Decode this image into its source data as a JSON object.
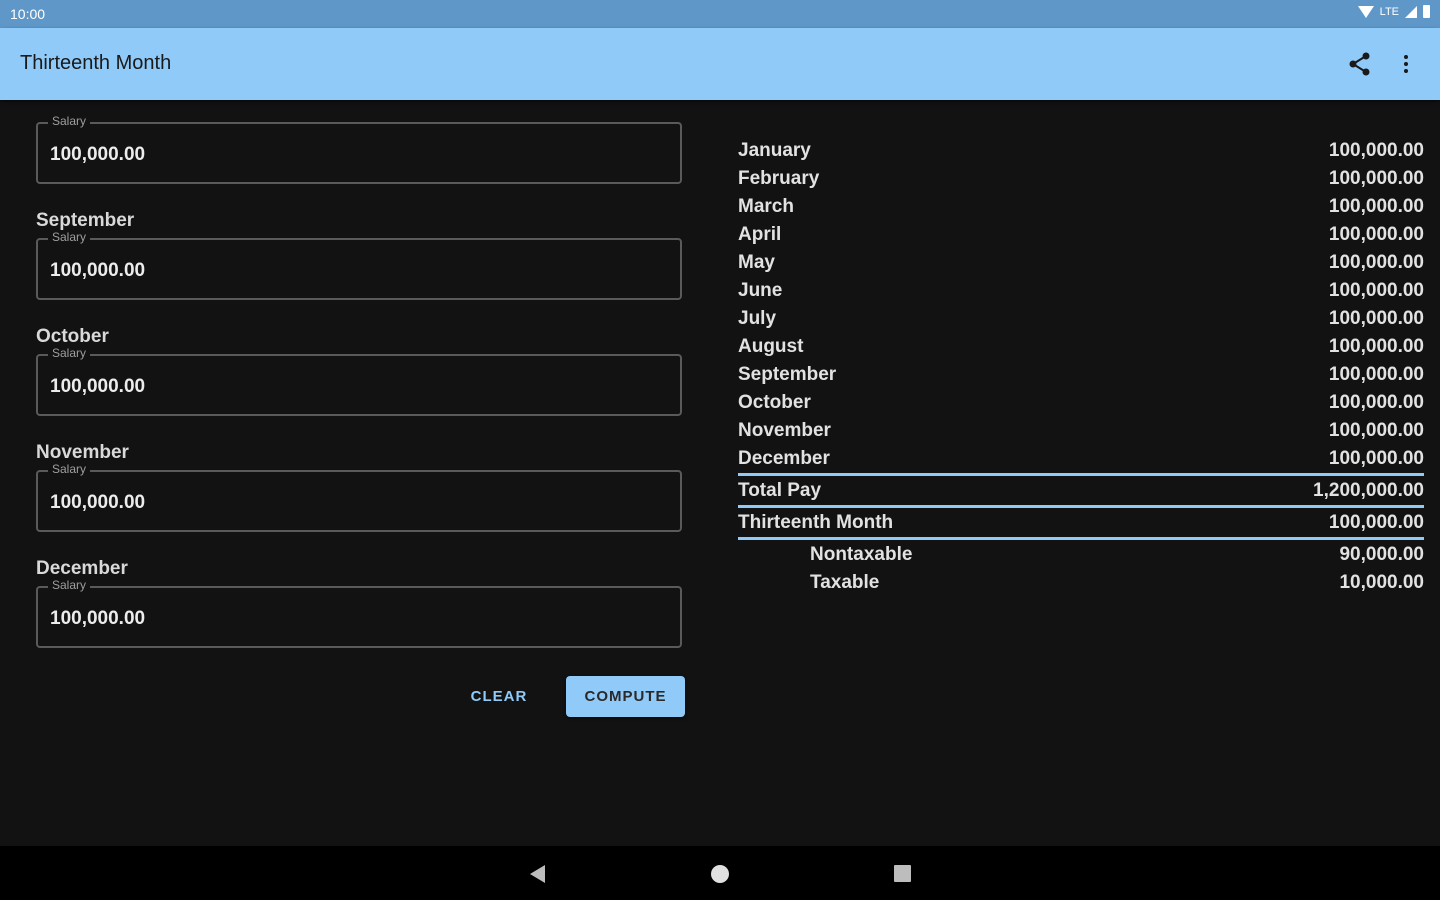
{
  "status_bar": {
    "time": "10:00",
    "network": "LTE"
  },
  "app_bar": {
    "title": "Thirteenth Month"
  },
  "form": {
    "first_field": {
      "label": "Salary",
      "value": "100,000.00"
    },
    "months": [
      {
        "month": "September",
        "label": "Salary",
        "value": "100,000.00"
      },
      {
        "month": "October",
        "label": "Salary",
        "value": "100,000.00"
      },
      {
        "month": "November",
        "label": "Salary",
        "value": "100,000.00"
      },
      {
        "month": "December",
        "label": "Salary",
        "value": "100,000.00"
      }
    ],
    "clear_label": "CLEAR",
    "compute_label": "COMPUTE"
  },
  "summary": {
    "months": [
      {
        "label": "January",
        "value": "100,000.00"
      },
      {
        "label": "February",
        "value": "100,000.00"
      },
      {
        "label": "March",
        "value": "100,000.00"
      },
      {
        "label": "April",
        "value": "100,000.00"
      },
      {
        "label": "May",
        "value": "100,000.00"
      },
      {
        "label": "June",
        "value": "100,000.00"
      },
      {
        "label": "July",
        "value": "100,000.00"
      },
      {
        "label": "August",
        "value": "100,000.00"
      },
      {
        "label": "September",
        "value": "100,000.00"
      },
      {
        "label": "October",
        "value": "100,000.00"
      },
      {
        "label": "November",
        "value": "100,000.00"
      },
      {
        "label": "December",
        "value": "100,000.00"
      }
    ],
    "total_pay": {
      "label": "Total Pay",
      "value": "1,200,000.00"
    },
    "thirteenth_month": {
      "label": "Thirteenth Month",
      "value": "100,000.00"
    },
    "nontaxable": {
      "label": "Nontaxable",
      "value": "90,000.00"
    },
    "taxable": {
      "label": "Taxable",
      "value": "10,000.00"
    }
  },
  "colors": {
    "accent": "#90caf9",
    "status_bar": "#5f98c8",
    "background": "#121212"
  },
  "icons": {
    "share": "share-icon",
    "more": "more-vert-icon",
    "back": "back-icon",
    "home": "home-icon",
    "recents": "recents-icon"
  }
}
